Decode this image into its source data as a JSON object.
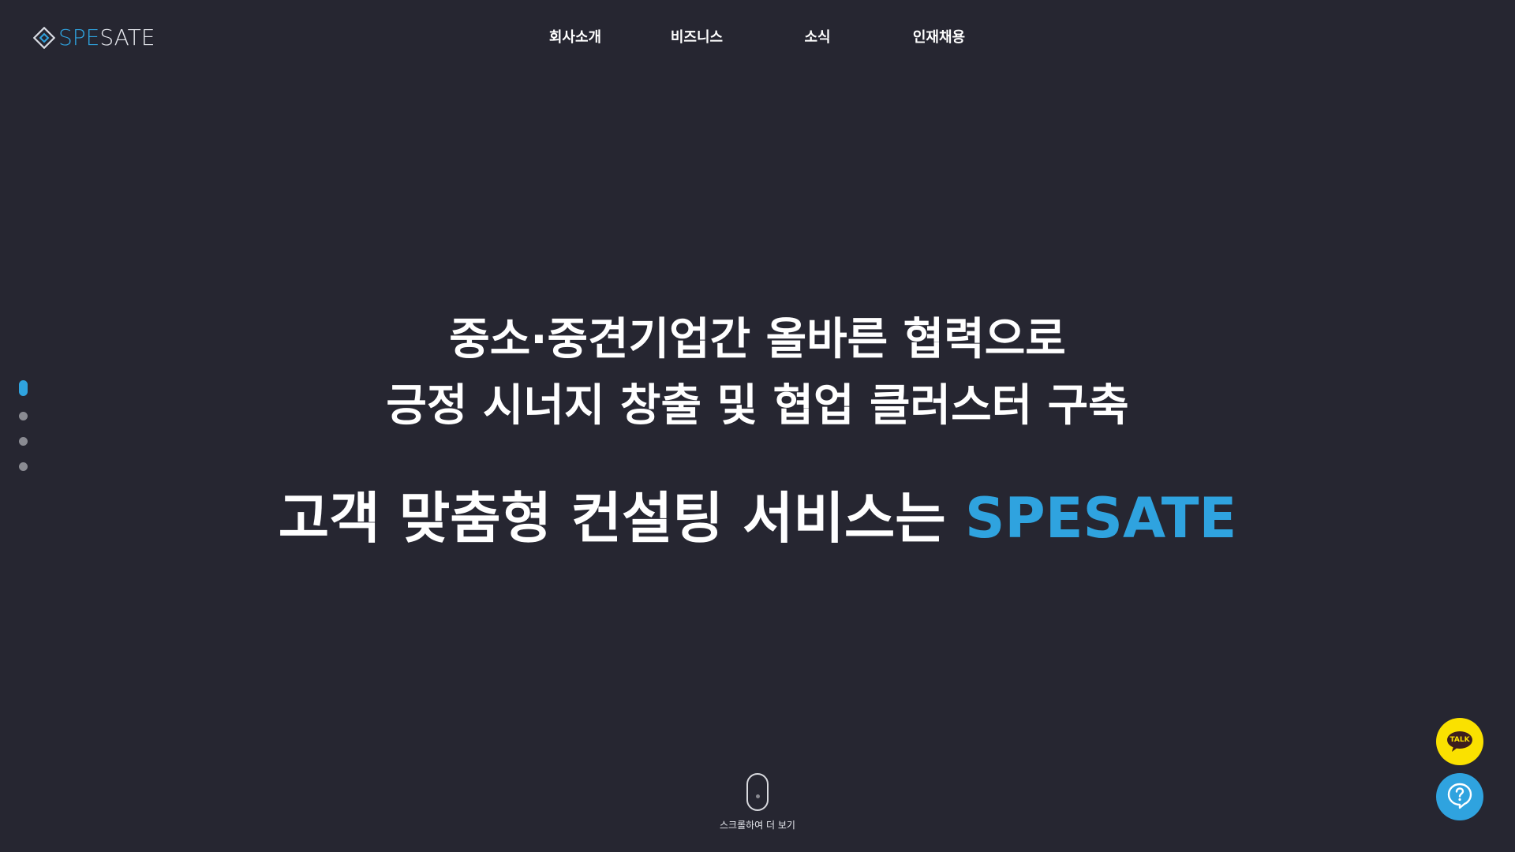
{
  "brand": {
    "logo_part1": "SPE",
    "logo_part2": "SATE",
    "logo_icon": "diamond-logo-icon",
    "accent_color": "#2fa3df",
    "background_color": "#262631"
  },
  "nav": {
    "items": [
      {
        "label": "회사소개"
      },
      {
        "label": "비즈니스"
      },
      {
        "label": "소식"
      },
      {
        "label": "인재채용"
      }
    ]
  },
  "section_indicator": {
    "count": 4,
    "active_index": 0
  },
  "hero": {
    "line1": "중소·중견기업간 올바른 협력으로",
    "line2": "긍정 시너지 창출 및 협업 클러스터 구축",
    "line3_prefix": "고객 맞춤형 컨설팅 서비스는 ",
    "line3_accent": "SPESATE"
  },
  "scroll_hint": {
    "icon": "mouse-scroll-icon",
    "label": "스크롤하여 더 보기"
  },
  "floating": {
    "talk_label": "TALK",
    "talk_icon": "kakao-talk-icon",
    "talk_color": "#fae100",
    "help_icon": "question-chat-icon",
    "help_color": "#2fa3df"
  }
}
